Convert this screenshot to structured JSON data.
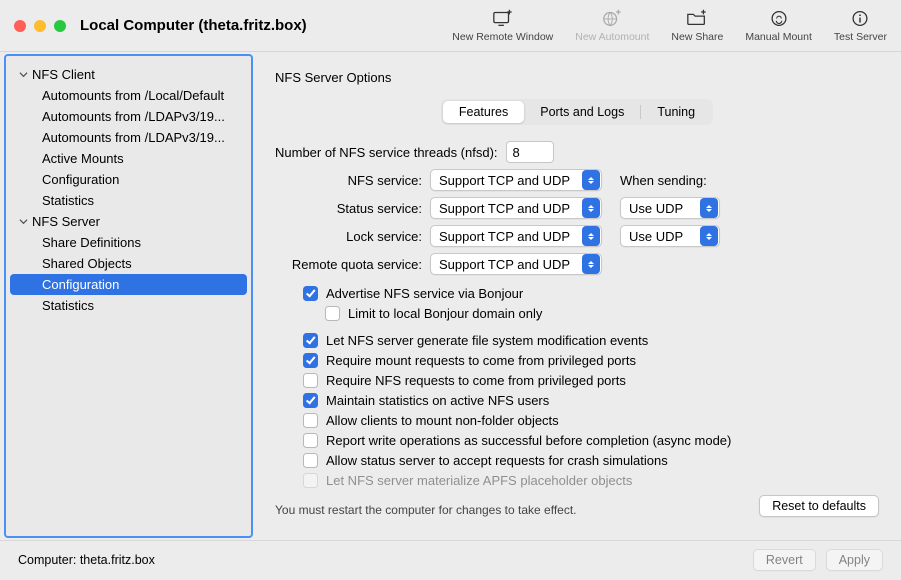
{
  "window": {
    "title": "Local Computer (theta.fritz.box)"
  },
  "toolbar": {
    "items": [
      {
        "label": "New Remote Window",
        "enabled": true
      },
      {
        "label": "New Automount",
        "enabled": false
      },
      {
        "label": "New Share",
        "enabled": true
      },
      {
        "label": "Manual Mount",
        "enabled": true
      },
      {
        "label": "Test Server",
        "enabled": true
      }
    ]
  },
  "sidebar": {
    "groups": [
      {
        "title": "NFS Client",
        "items": [
          "Automounts from /Local/Default",
          "Automounts from /LDAPv3/19...",
          "Automounts from /LDAPv3/19...",
          "Active Mounts",
          "Configuration",
          "Statistics"
        ],
        "selected": -1
      },
      {
        "title": "NFS Server",
        "items": [
          "Share Definitions",
          "Shared Objects",
          "Configuration",
          "Statistics"
        ],
        "selected": 2
      }
    ]
  },
  "main": {
    "heading": "NFS Server Options",
    "tabs": {
      "items": [
        "Features",
        "Ports and Logs",
        "Tuning"
      ],
      "active": 0
    },
    "threads": {
      "label": "Number of NFS service threads (nfsd):",
      "value": "8"
    },
    "services": {
      "nfs": {
        "label": "NFS service:",
        "value": "Support TCP and UDP"
      },
      "status": {
        "label": "Status service:",
        "value": "Support TCP and UDP"
      },
      "lock": {
        "label": "Lock service:",
        "value": "Support TCP and UDP"
      },
      "quota": {
        "label": "Remote quota service:",
        "value": "Support TCP and UDP"
      }
    },
    "when_sending": {
      "label": "When sending:",
      "status": "Use UDP",
      "lock": "Use UDP"
    },
    "options": {
      "bonjour": {
        "label": "Advertise NFS service via Bonjour",
        "checked": true
      },
      "bonjour_local": {
        "label": "Limit to local Bonjour domain only",
        "checked": false
      },
      "fsevents": {
        "label": "Let NFS server generate file system modification events",
        "checked": true
      },
      "priv_mount": {
        "label": "Require mount requests to come from privileged ports",
        "checked": true
      },
      "priv_nfs": {
        "label": "Require NFS requests to come from privileged ports",
        "checked": false
      },
      "stats": {
        "label": "Maintain statistics on active NFS users",
        "checked": true
      },
      "nonfolder": {
        "label": "Allow clients to mount non-folder objects",
        "checked": false
      },
      "async": {
        "label": "Report write operations as successful before completion (async mode)",
        "checked": false
      },
      "crash": {
        "label": "Allow status server to accept requests for crash simulations",
        "checked": false
      },
      "apfs": {
        "label": "Let NFS server materialize APFS placeholder objects",
        "checked": false,
        "disabled": true
      }
    },
    "hint": "You must restart the computer for changes to take effect.",
    "reset_label": "Reset to defaults"
  },
  "footer": {
    "computer_label": "Computer: theta.fritz.box",
    "revert": "Revert",
    "apply": "Apply"
  }
}
